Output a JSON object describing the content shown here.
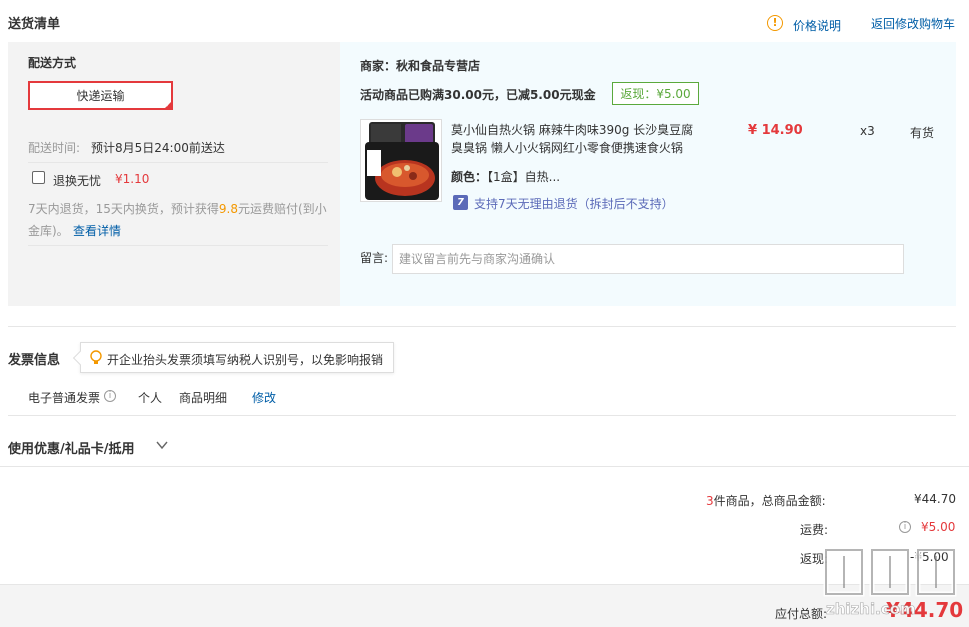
{
  "header": {
    "title": "送货清单",
    "price_note": "价格说明",
    "back_to_cart": "返回修改购物车"
  },
  "delivery": {
    "method_label": "配送方式",
    "method_button": "快递运输",
    "time_label": "配送时间:",
    "time_value": "预计8月5日24:00前送达",
    "insurance_label": "退换无忧",
    "insurance_price": "¥1.10",
    "insurance_desc_1": "7天内退货，15天内换货，预计获得",
    "insurance_amount": "9.8",
    "insurance_desc_2": "元运费赔付(到小",
    "insurance_desc_3": "金库)。",
    "details_link": "查看详情"
  },
  "order": {
    "merchant": "商家：秋和食品专营店",
    "promo": "活动商品已购满30.00元，已减5.00元现金",
    "cashback": "返现：¥5.00",
    "product_title_line1": "莫小仙自热火锅 麻辣牛肉味390g 长沙臭豆腐",
    "product_title_line2": "臭臭锅 懒人小火锅网红小零食便携速食火锅",
    "color_label": "颜色：",
    "color_value": "【1盒】自热...",
    "price": "¥ 14.90",
    "quantity": "x3",
    "stock": "有货",
    "return_badge": "7",
    "return_policy": "支持7天无理由退货（拆封后不支持）",
    "remark_label": "留言:",
    "remark_placeholder": "建议留言前先与商家沟通确认"
  },
  "invoice": {
    "title": "发票信息",
    "tip": "开企业抬头发票须填写纳税人识别号，以免影响报销",
    "type": "电子普通发票",
    "header_type": "个人",
    "content": "商品明细",
    "edit": "修改"
  },
  "coupon": {
    "label": "使用优惠/礼品卡/抵用"
  },
  "summary": {
    "count": "3",
    "count_suffix": "件商品，总商品金额:",
    "total": "¥44.70",
    "shipping_label": "运费:",
    "shipping_value": "¥5.00",
    "cashback_label": "返现:",
    "cashback_value": "-¥5.00",
    "payable_label": "应付总额:",
    "payable_value": "¥44.70"
  },
  "watermark": {
    "text": "zhizhi.com"
  },
  "colors": {
    "accent_red": "#e4393c",
    "link_blue": "#005ea7",
    "cashback_green": "#5ba93c",
    "warn_orange": "#f39800"
  }
}
